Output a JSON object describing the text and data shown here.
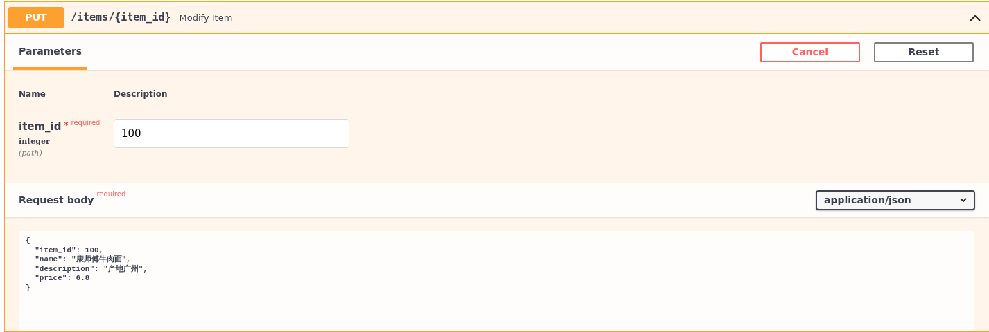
{
  "operation": {
    "method": "PUT",
    "path": "/items/{item_id}",
    "summary": "Modify Item",
    "expanded": true
  },
  "tabs": [
    {
      "label": "Parameters",
      "selected": true
    }
  ],
  "buttons": [
    {
      "label": "Cancel",
      "kind": "cancel"
    },
    {
      "label": "Reset",
      "kind": "reset"
    }
  ],
  "parameters": {
    "columns": [
      "Name",
      "Description"
    ],
    "rows": [
      {
        "name": "item_id",
        "required_mark": "*",
        "required_label": "required",
        "type": "integer",
        "location": "(path)",
        "value": "100"
      }
    ]
  },
  "request_body": {
    "title": "Request body",
    "required_label": "required",
    "content_type": "application/json",
    "lines": [
      "{",
      "  \"item_id\": 100,",
      "  \"name\": \"康师傅牛肉面\",",
      "  \"description\": \"产地广州\",",
      "  \"price\": 6.8",
      "}"
    ]
  }
}
